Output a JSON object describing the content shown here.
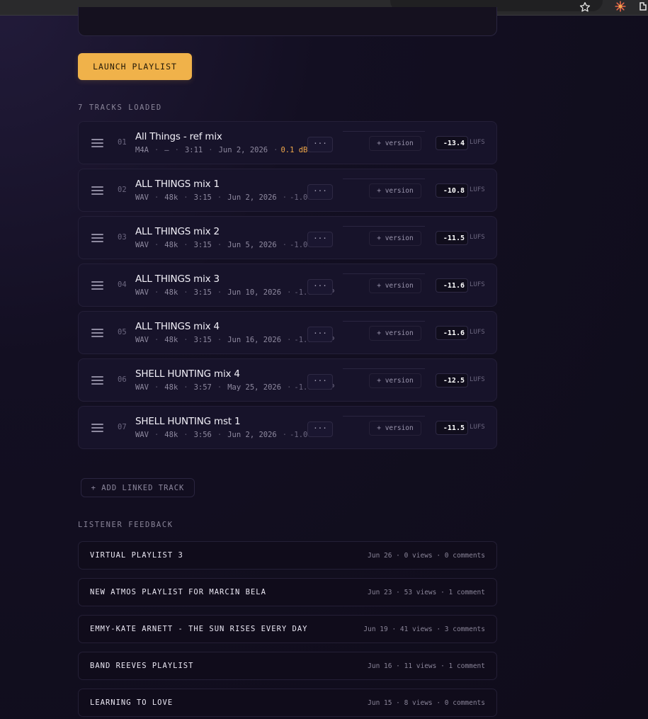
{
  "browser": {
    "star_icon": "star-outline-icon",
    "extension_icon": "sunburst-icon"
  },
  "launch_label": "LAUNCH PLAYLIST",
  "tracks_loaded": "7 TRACKS LOADED",
  "separator": "·",
  "more_label": "...",
  "version_label": "+ version",
  "lufs_unit": "LUFS",
  "tracks": [
    {
      "num": "01",
      "title": "All Things - ref mix",
      "format": "M4A",
      "rate": "—",
      "duration": "3:11",
      "date": "Jun 2, 2026",
      "peak": "0.1 dBTP ⚠",
      "peak_warn": true,
      "lufs": "-13.4"
    },
    {
      "num": "02",
      "title": "ALL THINGS mix 1",
      "format": "WAV",
      "rate": "48k",
      "duration": "3:15",
      "date": "Jun 2, 2026",
      "peak": "-1.0 dBTP",
      "peak_warn": false,
      "lufs": "-10.8"
    },
    {
      "num": "03",
      "title": "ALL THINGS mix 2",
      "format": "WAV",
      "rate": "48k",
      "duration": "3:15",
      "date": "Jun 5, 2026",
      "peak": "-1.0 dBTP",
      "peak_warn": false,
      "lufs": "-11.5"
    },
    {
      "num": "04",
      "title": "ALL THINGS mix 3",
      "format": "WAV",
      "rate": "48k",
      "duration": "3:15",
      "date": "Jun 10, 2026",
      "peak": "-1.0 dBTP",
      "peak_warn": false,
      "lufs": "-11.6"
    },
    {
      "num": "05",
      "title": "ALL THINGS mix 4",
      "format": "WAV",
      "rate": "48k",
      "duration": "3:15",
      "date": "Jun 16, 2026",
      "peak": "-1.0 dBTP",
      "peak_warn": false,
      "lufs": "-11.6"
    },
    {
      "num": "06",
      "title": "SHELL HUNTING mix 4",
      "format": "WAV",
      "rate": "48k",
      "duration": "3:57",
      "date": "May 25, 2026",
      "peak": "-1.0 dBTP",
      "peak_warn": false,
      "lufs": "-12.5"
    },
    {
      "num": "07",
      "title": "SHELL HUNTING mst 1",
      "format": "WAV",
      "rate": "48k",
      "duration": "3:56",
      "date": "Jun 2, 2026",
      "peak": "-1.0 dBTP",
      "peak_warn": false,
      "lufs": "-11.5"
    }
  ],
  "add_linked_label": "+ ADD LINKED TRACK",
  "listener_feedback_label": "LISTENER FEEDBACK",
  "feedback": [
    {
      "title": "VIRTUAL PLAYLIST 3",
      "meta": "Jun 26 · 0 views · 0 comments"
    },
    {
      "title": "NEW ATMOS PLAYLIST FOR MARCIN BELA",
      "meta": "Jun 23 · 53 views · 1 comment"
    },
    {
      "title": "EMMY-KATE ARNETT - THE SUN RISES EVERY DAY",
      "meta": "Jun 19 · 41 views · 3 comments"
    },
    {
      "title": "BAND REEVES PLAYLIST",
      "meta": "Jun 16 · 11 views · 1 comment"
    },
    {
      "title": "LEARNING TO LOVE",
      "meta": "Jun 15 · 8 views · 0 comments"
    }
  ]
}
